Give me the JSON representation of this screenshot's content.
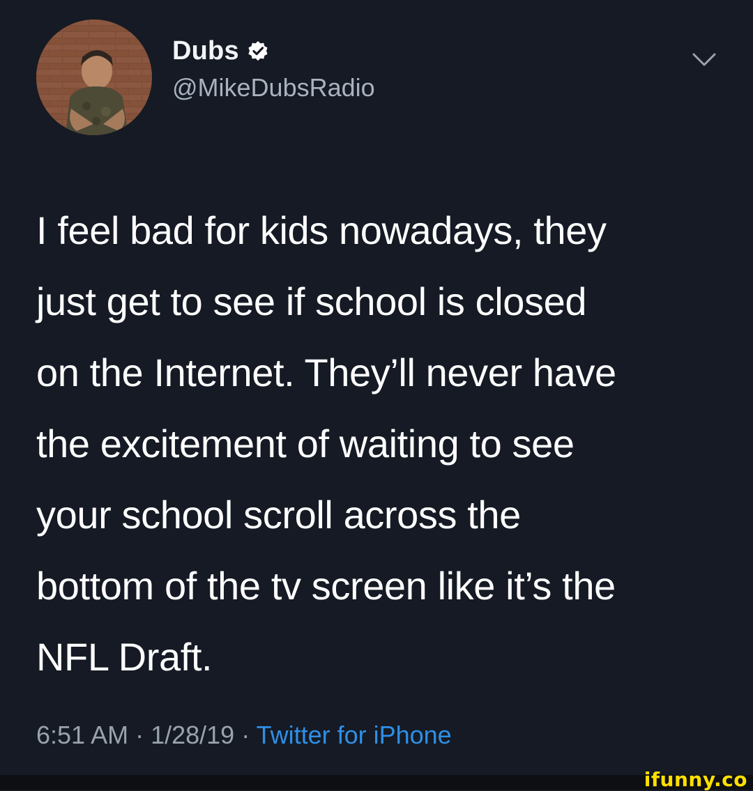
{
  "tweet": {
    "author_name": "Dubs",
    "handle": "@MikeDubsRadio",
    "text_lines": [
      "I feel bad for kids nowadays, they",
      "just get to see if school is closed",
      "on the Internet. They’ll never have",
      "the excitement of waiting to see",
      "your school scroll across the",
      "bottom of the tv screen like it’s the",
      "NFL Draft."
    ],
    "time": "6:51 AM",
    "separator": " · ",
    "date": "1/28/19",
    "source": "Twitter for iPhone"
  },
  "icons": {
    "verified": "verified-badge-icon",
    "menu": "chevron-down-icon"
  },
  "watermark": {
    "text": "ifunny.co"
  },
  "colors": {
    "background": "#151a24",
    "text": "#ffffff",
    "muted": "#9aa3ad",
    "link": "#2f8fe7",
    "watermark": "#ffe000"
  }
}
